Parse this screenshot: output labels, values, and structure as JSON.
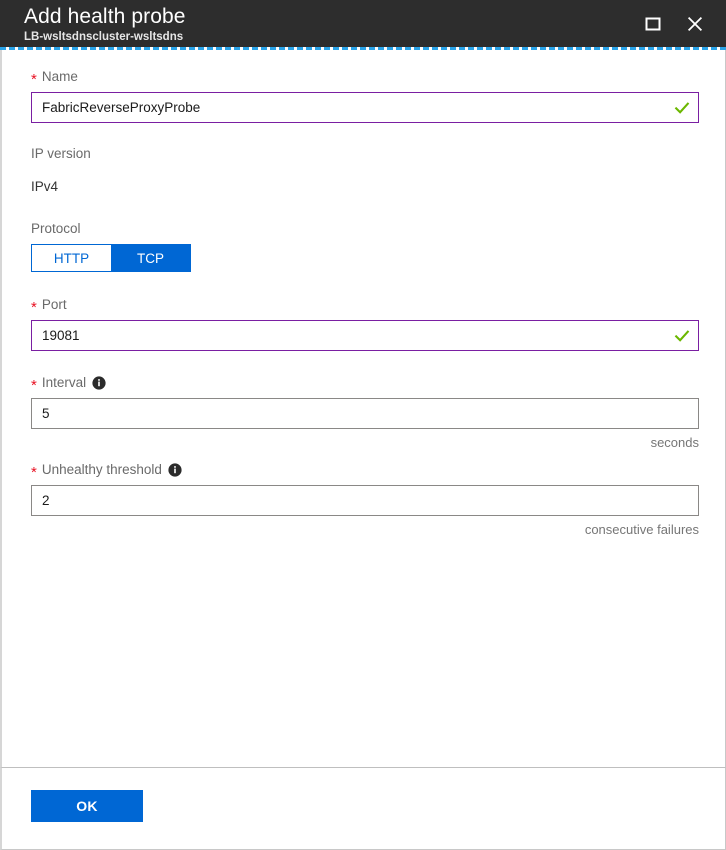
{
  "header": {
    "title": "Add health probe",
    "subtitle": "LB-wsltsdnscluster-wsltsdns",
    "maximize_icon": "maximize-icon",
    "close_icon": "close-icon",
    "background_color": "#2d2d2d",
    "focus_rule_color": "#2aa3e8"
  },
  "form": {
    "name": {
      "label": "Name",
      "required_marker": "*",
      "value": "FabricReverseProxyProbe",
      "placeholder": "",
      "valid": true,
      "border_color": "#7a1fa2",
      "check_color": "#6bb700"
    },
    "ip_version": {
      "label": "IP version",
      "value": "IPv4"
    },
    "protocol": {
      "label": "Protocol",
      "options": [
        "HTTP",
        "TCP"
      ],
      "selected": "TCP",
      "accent_color": "#0067d4"
    },
    "port": {
      "label": "Port",
      "required_marker": "*",
      "value": "19081",
      "placeholder": "",
      "valid": true,
      "border_color": "#7a1fa2",
      "check_color": "#6bb700"
    },
    "interval": {
      "label": "Interval",
      "required_marker": "*",
      "info_icon": "info-icon",
      "value": "5",
      "placeholder": "",
      "helper": "seconds"
    },
    "unhealthy_threshold": {
      "label": "Unhealthy threshold",
      "required_marker": "*",
      "info_icon": "info-icon",
      "value": "2",
      "placeholder": "",
      "helper": "consecutive failures"
    }
  },
  "footer": {
    "ok_label": "OK",
    "ok_color": "#0067d4"
  }
}
